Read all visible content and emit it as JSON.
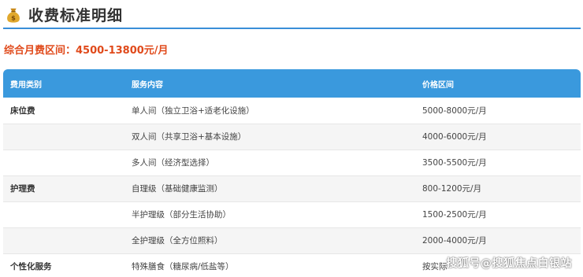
{
  "header": {
    "title": "收费标准明细",
    "icon": "money-bag-icon"
  },
  "summary": {
    "text": "综合月费区间：4500-13800元/月"
  },
  "colors": {
    "accent": "#3a99dd",
    "highlight": "#e04a1b"
  },
  "table": {
    "columns": [
      "费用类别",
      "服务内容",
      "价格区间"
    ],
    "rows": [
      {
        "category": "床位费",
        "service": "单人间（独立卫浴+适老化设施）",
        "price": "5000-8000元/月"
      },
      {
        "category": "",
        "service": "双人间（共享卫浴+基本设施）",
        "price": "4000-6000元/月"
      },
      {
        "category": "",
        "service": "多人间（经济型选择）",
        "price": "3500-5500元/月"
      },
      {
        "category": "护理费",
        "service": "自理级（基础健康监测）",
        "price": "800-1200元/月"
      },
      {
        "category": "",
        "service": "半护理级（部分生活协助）",
        "price": "1500-2500元/月"
      },
      {
        "category": "",
        "service": "全护理级（全方位照料）",
        "price": "2000-4000元/月"
      },
      {
        "category": "个性化服务",
        "service": "特殊膳食（糖尿病/低盐等）",
        "price": "按实际"
      }
    ]
  },
  "watermark": "搜狐号@搜狐焦点白银站"
}
